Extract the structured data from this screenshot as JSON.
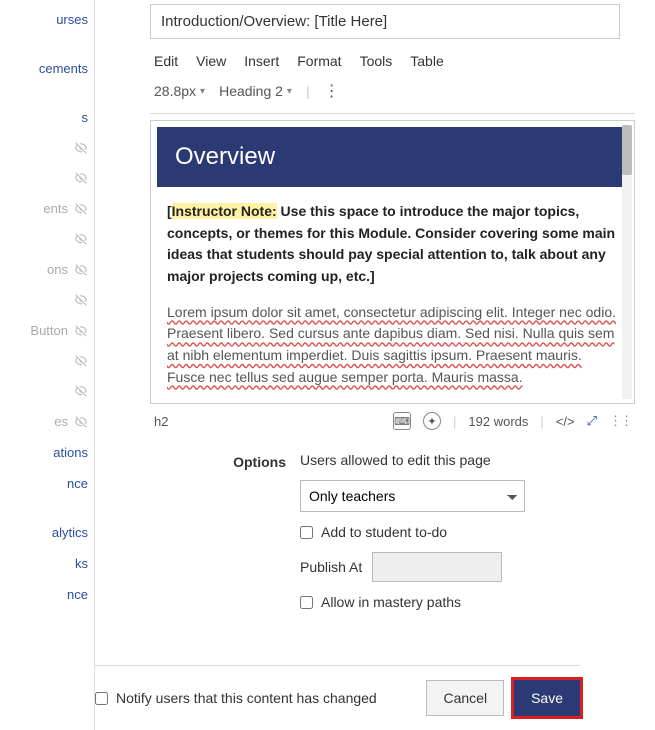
{
  "sidebar": {
    "items": [
      {
        "label": "urses",
        "hidden": false
      },
      {
        "label": "",
        "hidden": false,
        "spacer": true
      },
      {
        "label": "cements",
        "hidden": false
      },
      {
        "label": "",
        "hidden": false,
        "spacer": true
      },
      {
        "label": "s",
        "hidden": false
      },
      {
        "label": "",
        "hidden": true
      },
      {
        "label": "",
        "hidden": true
      },
      {
        "label": "ents",
        "hidden": true
      },
      {
        "label": "",
        "hidden": true
      },
      {
        "label": "ons",
        "hidden": true
      },
      {
        "label": "",
        "hidden": true
      },
      {
        "label": "Button",
        "hidden": true
      },
      {
        "label": "",
        "hidden": true
      },
      {
        "label": "",
        "hidden": true
      },
      {
        "label": "es",
        "hidden": true
      },
      {
        "label": "ations",
        "hidden": false
      },
      {
        "label": "nce",
        "hidden": false
      },
      {
        "label": "",
        "spacer": true
      },
      {
        "label": "alytics",
        "hidden": false
      },
      {
        "label": "ks",
        "hidden": false
      },
      {
        "label": "nce",
        "hidden": false
      }
    ]
  },
  "title_input": "Introduction/Overview: [Title Here]",
  "menubar": [
    "Edit",
    "View",
    "Insert",
    "Format",
    "Tools",
    "Table"
  ],
  "toolbar": {
    "font_size": "28.8px",
    "block_type": "Heading 2"
  },
  "editor": {
    "banner": "Overview",
    "note_bracket_open": "[",
    "note_highlight": "Instructor Note:",
    "note_body": " Use this space to introduce the major topics, concepts, or themes for this Module. Consider covering some main ideas that students should pay special attention to, talk about any major projects coming up, etc.]",
    "lorem": "Lorem ipsum dolor sit amet, consectetur adipiscing elit. Integer nec odio. Praesent libero. Sed cursus ante dapibus diam. Sed nisi. Nulla quis sem at nibh elementum imperdiet. Duis sagittis ipsum. Praesent mauris. Fusce nec tellus sed augue semper porta. Mauris massa."
  },
  "status": {
    "el_path": "h2",
    "word_count": "192 words",
    "html_toggle": "</>"
  },
  "options": {
    "section_label": "Options",
    "edit_label": "Users allowed to edit this page",
    "select_value": "Only teachers",
    "todo_label": "Add to student to-do",
    "publish_label": "Publish At",
    "mastery_label": "Allow in mastery paths"
  },
  "footer": {
    "notify_label": "Notify users that this content has changed",
    "cancel": "Cancel",
    "save": "Save"
  }
}
